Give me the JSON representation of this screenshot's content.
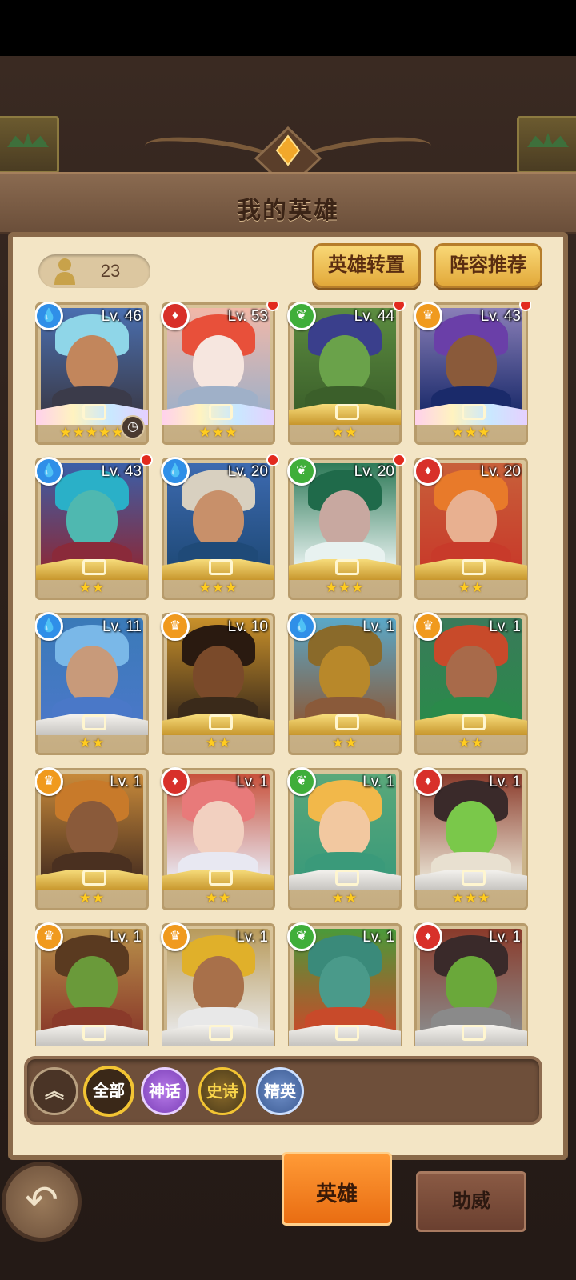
{
  "screen": {
    "title": "我的英雄",
    "hero_count": "23"
  },
  "header_buttons": {
    "transfer": "英雄转置",
    "lineup": "阵容推荐"
  },
  "factions": {
    "water": {
      "color": "#2f8fe8",
      "icon": "droplet-icon"
    },
    "fire": {
      "color": "#d8302a",
      "icon": "flame-icon"
    },
    "nature": {
      "color": "#3fae3a",
      "icon": "leaf-icon"
    },
    "light": {
      "color": "#f09a1e",
      "icon": "crown-icon"
    }
  },
  "heroes": [
    {
      "level": "Lv. 46",
      "faction": "water",
      "stars": "★★★★★",
      "tier": "rainbow",
      "dot": false,
      "timer": true,
      "palette": [
        "#4a6fb0",
        "#8fd6e8",
        "#c2865c",
        "#3b3b4a"
      ]
    },
    {
      "level": "Lv. 53",
      "faction": "fire",
      "stars": "★★★",
      "tier": "rainbow",
      "dot": true,
      "timer": false,
      "palette": [
        "#f2b8a8",
        "#e8503a",
        "#f6e6df",
        "#9fb0c8"
      ]
    },
    {
      "level": "Lv. 44",
      "faction": "nature",
      "stars": "★★",
      "tier": "gold",
      "dot": true,
      "timer": false,
      "palette": [
        "#5c8c40",
        "#3a3f8c",
        "#6aa24a",
        "#3b5f2a"
      ]
    },
    {
      "level": "Lv. 43",
      "faction": "light",
      "stars": "★★★",
      "tier": "rainbow",
      "dot": true,
      "timer": false,
      "palette": [
        "#8a7fb8",
        "#6a3fa8",
        "#8a5a3a",
        "#1a2a6a"
      ]
    },
    {
      "level": "Lv. 43",
      "faction": "water",
      "stars": "★★",
      "tier": "gold",
      "dot": true,
      "timer": false,
      "palette": [
        "#3a5fa8",
        "#2ab0c8",
        "#4fb8b0",
        "#8a2a3a"
      ]
    },
    {
      "level": "Lv. 20",
      "faction": "water",
      "stars": "★★★",
      "tier": "gold",
      "dot": true,
      "timer": false,
      "palette": [
        "#3d6ab0",
        "#d8d0c0",
        "#c8906a",
        "#1f4a78"
      ]
    },
    {
      "level": "Lv. 20",
      "faction": "nature",
      "stars": "★★★",
      "tier": "gold",
      "dot": true,
      "timer": false,
      "palette": [
        "#2e7a58",
        "#1f6a4a",
        "#c8a8a0",
        "#e8f2f0"
      ]
    },
    {
      "level": "Lv. 20",
      "faction": "fire",
      "stars": "★★",
      "tier": "gold",
      "dot": false,
      "timer": false,
      "palette": [
        "#c8603a",
        "#e87a2a",
        "#e8b090",
        "#c83a2a"
      ]
    },
    {
      "level": "Lv. 11",
      "faction": "water",
      "stars": "★★",
      "tier": "silver",
      "dot": false,
      "timer": false,
      "palette": [
        "#3a7ab8",
        "#7ab8e8",
        "#c89a7a",
        "#4a78c8"
      ]
    },
    {
      "level": "Lv. 10",
      "faction": "light",
      "stars": "★★",
      "tier": "gold",
      "dot": false,
      "timer": false,
      "palette": [
        "#c8902a",
        "#2a1a10",
        "#7a4a2a",
        "#3a2a1a"
      ]
    },
    {
      "level": "Lv. 1",
      "faction": "water",
      "stars": "★★",
      "tier": "gold",
      "dot": false,
      "timer": false,
      "palette": [
        "#5aa8c8",
        "#8a6a2a",
        "#b8882a",
        "#8a5a3a"
      ]
    },
    {
      "level": "Lv. 1",
      "faction": "light",
      "stars": "★★",
      "tier": "gold",
      "dot": false,
      "timer": false,
      "palette": [
        "#3a7a5a",
        "#c84a2a",
        "#a86a4a",
        "#2a8a4a"
      ]
    },
    {
      "level": "Lv. 1",
      "faction": "light",
      "stars": "★★",
      "tier": "gold",
      "dot": false,
      "timer": false,
      "palette": [
        "#c88a3a",
        "#c87a2a",
        "#8a5a3a",
        "#4a3020"
      ]
    },
    {
      "level": "Lv. 1",
      "faction": "fire",
      "stars": "★★",
      "tier": "gold",
      "dot": false,
      "timer": false,
      "palette": [
        "#c8503a",
        "#e87a7a",
        "#f2d0c0",
        "#e8e8f2"
      ]
    },
    {
      "level": "Lv. 1",
      "faction": "nature",
      "stars": "★★",
      "tier": "silver",
      "dot": false,
      "timer": false,
      "palette": [
        "#5aa87a",
        "#f2b84a",
        "#f2c8a0",
        "#3a9a7a"
      ]
    },
    {
      "level": "Lv. 1",
      "faction": "fire",
      "stars": "★★★",
      "tier": "silver",
      "dot": false,
      "timer": false,
      "palette": [
        "#8a3a2a",
        "#3a2a2a",
        "#7ac84a",
        "#e8e0d0"
      ]
    },
    {
      "level": "Lv. 1",
      "faction": "light",
      "stars": "",
      "tier": "silver",
      "dot": false,
      "timer": false,
      "palette": [
        "#b8904a",
        "#5a3a20",
        "#6a9a3a",
        "#8a3a2a"
      ]
    },
    {
      "level": "Lv. 1",
      "faction": "light",
      "stars": "",
      "tier": "silver",
      "dot": false,
      "timer": false,
      "palette": [
        "#b89a5a",
        "#e0b02a",
        "#a8704a",
        "#e8e8e8"
      ]
    },
    {
      "level": "Lv. 1",
      "faction": "nature",
      "stars": "",
      "tier": "silver",
      "dot": false,
      "timer": false,
      "palette": [
        "#4a9a3a",
        "#3a8a7a",
        "#4a9a8a",
        "#c84a2a"
      ]
    },
    {
      "level": "Lv. 1",
      "faction": "fire",
      "stars": "",
      "tier": "silver",
      "dot": false,
      "timer": false,
      "palette": [
        "#8a3a2a",
        "#3a2a2a",
        "#6aa83a",
        "#8a8a8a"
      ]
    }
  ],
  "filters": {
    "collapse_icon": "double-chevron-up-icon",
    "all": "全部",
    "mythic": "神话",
    "epic": "史诗",
    "elite": "精英"
  },
  "nav": {
    "back_icon": "back-arrow-icon",
    "back_glyph": "↶",
    "tab_heroes": "英雄",
    "tab_support": "助威"
  }
}
